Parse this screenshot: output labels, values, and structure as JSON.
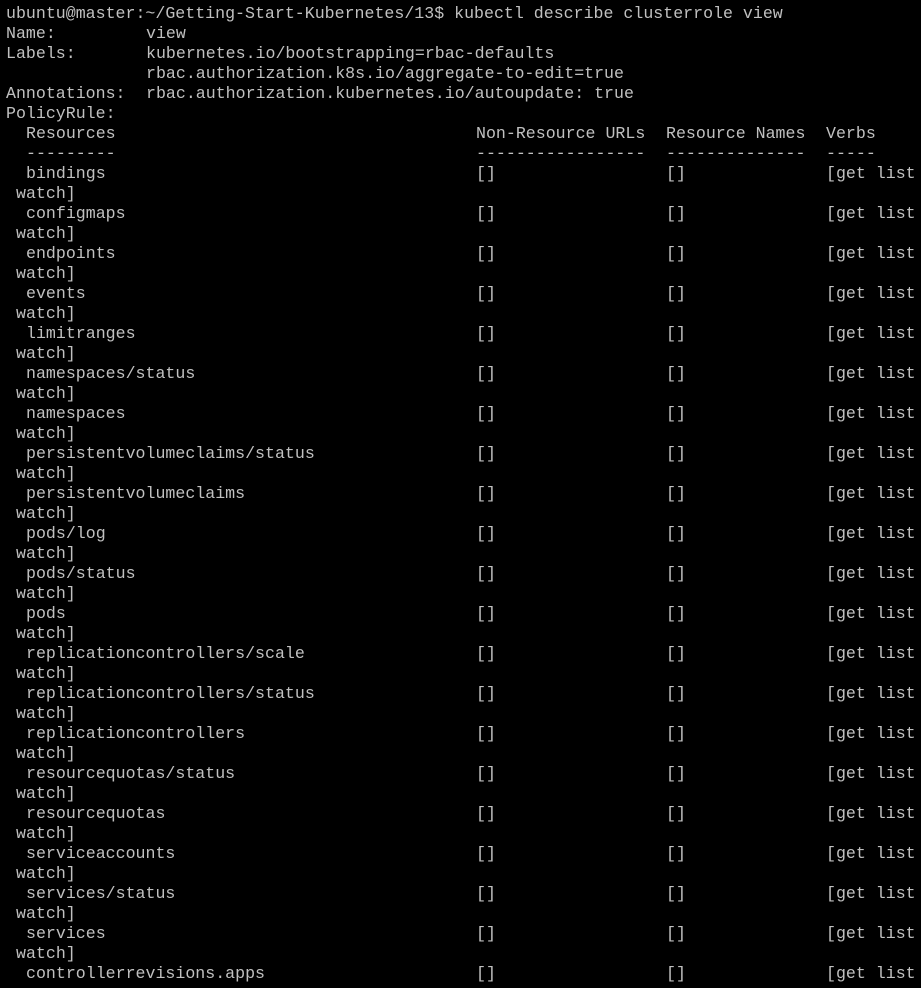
{
  "prompt": {
    "text": "ubuntu@master:~/Getting-Start-Kubernetes/13$",
    "command": "kubectl describe clusterrole view"
  },
  "meta": {
    "name_key": "Name:",
    "name_value": "view",
    "labels_key": "Labels:",
    "labels": [
      "kubernetes.io/bootstrapping=rbac-defaults",
      "rbac.authorization.k8s.io/aggregate-to-edit=true"
    ],
    "annotations_key": "Annotations:",
    "annotations_value": "rbac.authorization.kubernetes.io/autoupdate: true",
    "policy_key": "PolicyRule:"
  },
  "table": {
    "headers": {
      "resources": "Resources",
      "non_resource_urls": "Non-Resource URLs",
      "resource_names": "Resource Names",
      "verbs": "Verbs"
    },
    "separators": {
      "resources": "---------",
      "non_resource_urls": "-----------------",
      "resource_names": "--------------",
      "verbs": "-----"
    },
    "verbs_head": "[get list",
    "verbs_tail": "watch]",
    "empty": "[]",
    "rows": [
      "bindings",
      "configmaps",
      "endpoints",
      "events",
      "limitranges",
      "namespaces/status",
      "namespaces",
      "persistentvolumeclaims/status",
      "persistentvolumeclaims",
      "pods/log",
      "pods/status",
      "pods",
      "replicationcontrollers/scale",
      "replicationcontrollers/status",
      "replicationcontrollers",
      "resourcequotas/status",
      "resourcequotas",
      "serviceaccounts",
      "services/status",
      "services",
      "controllerrevisions.apps"
    ]
  }
}
